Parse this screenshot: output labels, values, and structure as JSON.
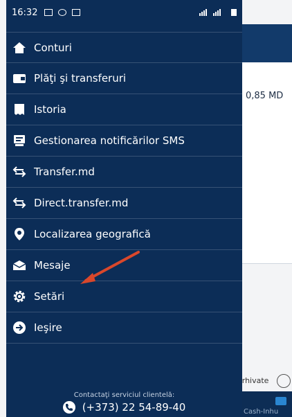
{
  "statusbar": {
    "time": "16:32"
  },
  "menu": {
    "items": [
      {
        "label": "Conturi",
        "icon": "home-icon"
      },
      {
        "label": "Plăţi şi transferuri",
        "icon": "wallet-icon"
      },
      {
        "label": "Istoria",
        "icon": "history-icon"
      },
      {
        "label": "Gestionarea notificărilor SMS",
        "icon": "sms-icon"
      },
      {
        "label": "Transfer.md",
        "icon": "transfer-icon"
      },
      {
        "label": "Direct.transfer.md",
        "icon": "transfer-icon"
      },
      {
        "label": "Localizarea geografică",
        "icon": "location-pin-icon"
      },
      {
        "label": "Mesaje",
        "icon": "envelope-icon"
      },
      {
        "label": "Setări",
        "icon": "gear-icon"
      },
      {
        "label": "Ieşire",
        "icon": "exit-icon"
      }
    ]
  },
  "contact": {
    "label": "Contactaţi serviciul clientelă:",
    "phone": "(+373) 22 54-89-40"
  },
  "background": {
    "amount": "0,85 MD",
    "archive": "arhivate",
    "cash_label": "Cash-Inhu"
  },
  "colors": {
    "drawer": "#0c2d57",
    "annotation_arrow": "#d9472b"
  }
}
